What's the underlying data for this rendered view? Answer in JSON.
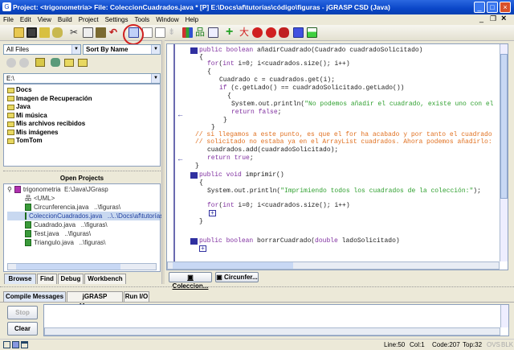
{
  "window": {
    "title": "Project: <trigonometria>    File: ColeccionCuadrados.java * [P]  E:\\Docs\\af\\tutorías\\código\\figuras  - jGRASP CSD (Java)",
    "app_icon": "G",
    "minimize": "_",
    "maximize": "□",
    "close": "×",
    "inner_minimize": "_",
    "inner_restore": "❐",
    "inner_close": "×"
  },
  "menu": [
    "File",
    "Edit",
    "View",
    "Build",
    "Project",
    "Settings",
    "Tools",
    "Window",
    "Help"
  ],
  "toolbar": {
    "icons": [
      "open-folder",
      "save",
      "browse-folder",
      "open-file",
      "cut",
      "copy",
      "paste",
      "undo",
      "generate-csd",
      "remove-csd",
      "new-file",
      "pin",
      "chart",
      "uml",
      "book",
      "compile",
      "run",
      "debug",
      "step",
      "step-into",
      "blue-square",
      "green-window"
    ]
  },
  "browser": {
    "filter": "All Files",
    "sort": "Sort By Name",
    "drive": "E:\\",
    "folders": [
      "Docs",
      "Imagen de Recuperación",
      "Java",
      "Mi música",
      "Mis archivos recibidos",
      "Mis imágenes",
      "TomTom"
    ]
  },
  "projects": {
    "header": "Open Projects",
    "root": "trigonometria",
    "root_path": "E:\\Java\\JGrasp",
    "uml": "<UML>",
    "files": [
      {
        "name": "Circunferencia.java",
        "path": "..\\figuras\\"
      },
      {
        "name": "ColeccionCuadrados.java",
        "path": "..\\..\\Docs\\af\\tutorías"
      },
      {
        "name": "Cuadrado.java",
        "path": "..\\figuras\\"
      },
      {
        "name": "Test.java",
        "path": "..\\figuras\\"
      },
      {
        "name": "Triangulo.java",
        "path": "..\\figuras\\"
      }
    ]
  },
  "left_tabs": [
    "Browse",
    "Find",
    "Debug",
    "Workbench"
  ],
  "editor": {
    "lines": [
      {
        "t": "public boolean añadirCuadrado(Cuadrado cuadradoSolicitado)"
      },
      {
        "t": "{"
      },
      {
        "t": "for(int i=0; i<cuadrados.size(); i++)"
      },
      {
        "t": "{"
      },
      {
        "t": "Cuadrado c = cuadrados.get(i);"
      },
      {
        "t": "if (c.getLado() == cuadradoSolicitado.getLado())"
      },
      {
        "t": "{"
      },
      {
        "t": "System.out.println(\"No podemos añadir el cuadrado, existe uno con el"
      },
      {
        "t": "return false;"
      },
      {
        "t": "}"
      },
      {
        "t": "}"
      },
      {
        "t": "// si llegamos a este punto, es que el for ha acabado y por tanto el cuadrado"
      },
      {
        "t": "// solicitado no estaba ya en el ArrayList cuadrados. Ahora podemos añadirlo:"
      },
      {
        "t": "cuadrados.add(cuadradoSolicitado);"
      },
      {
        "t": "return true;"
      },
      {
        "t": "}"
      },
      {
        "t": "public void imprimir()"
      },
      {
        "t": "{"
      },
      {
        "t": "System.out.println(\"Imprimiendo todos los cuadrados de la colección:\");"
      },
      {
        "t": "for(int i=0; i<cuadrados.size(); i++)"
      },
      {
        "t": "}"
      },
      {
        "t": "public boolean borrarCuadrado(double ladoSolicitado)"
      }
    ],
    "fold_marker": "+"
  },
  "window_tabs": [
    "Coleccion...",
    "Circunfer..."
  ],
  "bottom_tabs": [
    "Compile Messages",
    "jGRASP Messages",
    "Run I/O"
  ],
  "buttons": {
    "stop": "Stop",
    "clear": "Clear"
  },
  "status": {
    "line": "Line:50",
    "col": "Col:1",
    "code": "Code:207",
    "top": "Top:32",
    "ovs": "OVS",
    "blk": "BLK"
  }
}
